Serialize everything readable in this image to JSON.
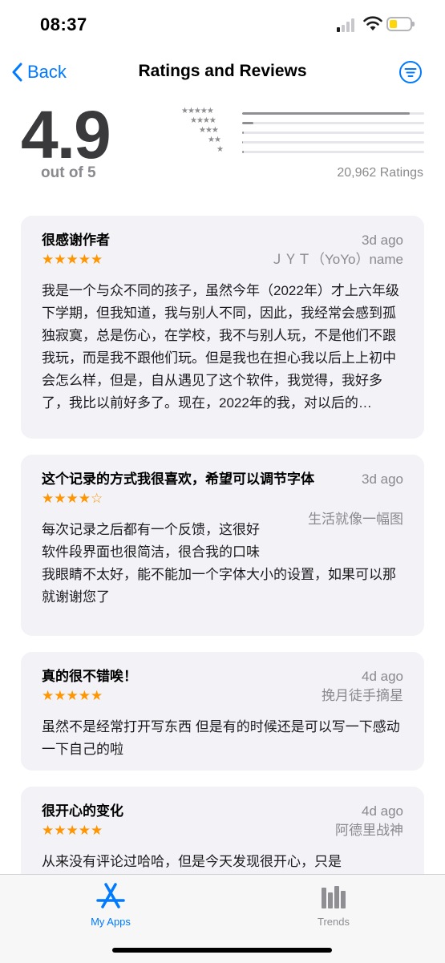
{
  "status": {
    "time": "08:37"
  },
  "nav": {
    "back_label": "Back",
    "title": "Ratings and Reviews"
  },
  "summary": {
    "average": "4.9",
    "out_of": "out of 5",
    "ratings_count": "20,962 Ratings",
    "histogram": [
      {
        "stars": 5,
        "fraction": 0.92
      },
      {
        "stars": 4,
        "fraction": 0.06
      },
      {
        "stars": 3,
        "fraction": 0.01
      },
      {
        "stars": 2,
        "fraction": 0.005
      },
      {
        "stars": 1,
        "fraction": 0.01
      }
    ]
  },
  "reviews": [
    {
      "title": "很感谢作者",
      "date": "3d ago",
      "stars": "★★★★★",
      "author": "ＪＹＴ（YoYo）name",
      "body": "我是一个与众不同的孩子，虽然今年（2022年）才上六年级下学期，但我知道，我与别人不同，因此，我经常会感到孤独寂寞，总是伤心，在学校，我不与别人玩，不是他们不跟我玩，而是我不跟他们玩。但是我也在担心我以后上上初中会怎么样，但是，自从遇见了这个软件，我觉得，我好多了，我比以前好多了。现在，2022年的我，对以后的…"
    },
    {
      "title": "这个记录的方式我很喜欢，希望可以调节字体",
      "date": "3d ago",
      "stars": "★★★★☆",
      "author": "生活就像一幅图",
      "body_lines": [
        "每次记录之后都有一个反馈，这很好",
        "软件段界面也很简洁，很合我的口味",
        "我眼睛不太好，能不能加一个字体大小的设置，如果可以那就谢谢您了"
      ]
    },
    {
      "title": "真的很不错唉！",
      "date": "4d ago",
      "stars": "★★★★★",
      "author": "挽月徒手摘星",
      "body": "虽然不是经常打开写东西 但是有的时候还是可以写一下感动一下自己的啦"
    },
    {
      "title": "很开心的变化",
      "date": "4d ago",
      "stars": "★★★★★",
      "author": "阿德里战神",
      "body": "从来没有评论过哈哈，但是今天发现很开心，只是"
    }
  ],
  "tabs": [
    {
      "label": "My Apps",
      "icon": "app-store-icon",
      "active": true
    },
    {
      "label": "Trends",
      "icon": "bar-chart-icon",
      "active": false
    }
  ],
  "colors": {
    "accent": "#007aff",
    "star": "#ff9500",
    "card_bg": "#f2f2f7"
  }
}
